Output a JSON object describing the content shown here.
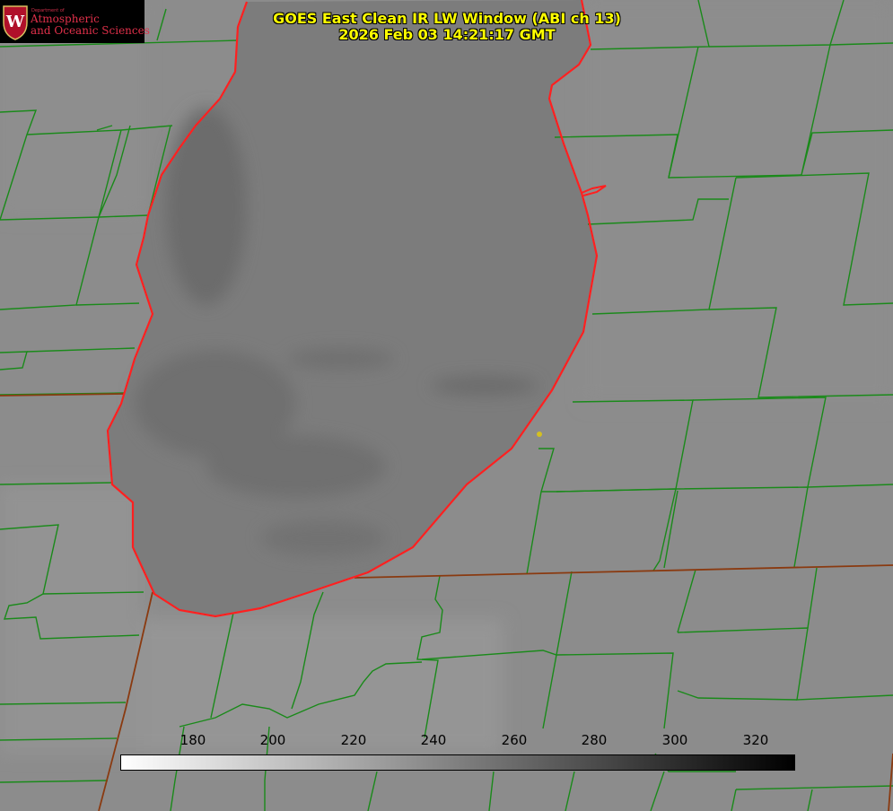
{
  "title": {
    "line1": "GOES East Clean IR LW Window (ABI ch 13)",
    "line2": "2026 Feb 03 14:21:17 GMT"
  },
  "logo": {
    "department": "Department of",
    "line1": "Atmospheric",
    "line2": "and Oceanic Sciences",
    "crest_letter": "W"
  },
  "colorbar": {
    "ticks": [
      "180",
      "200",
      "220",
      "240",
      "260",
      "280",
      "300",
      "320"
    ],
    "gradient": [
      "#ffffff",
      "#000000"
    ]
  },
  "colors": {
    "background": "#8a8a8a",
    "title": "#ffff00",
    "county_lines": "#1a8a1a",
    "state_lines": "#8a3a10",
    "coastline": "#ff2020",
    "marker": "#d4c020"
  }
}
